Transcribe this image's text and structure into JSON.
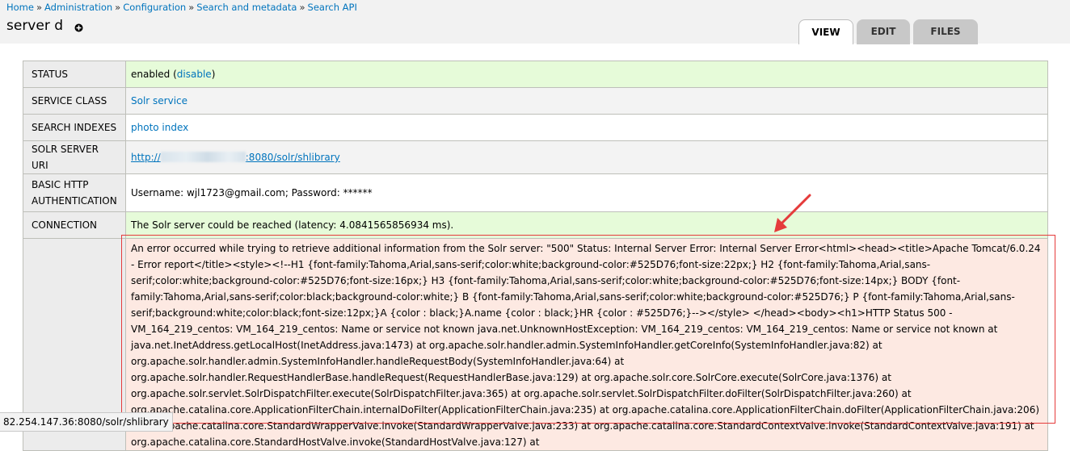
{
  "breadcrumb": {
    "items": [
      "Home",
      "Administration",
      "Configuration",
      "Search and metadata",
      "Search API"
    ],
    "separator": "»"
  },
  "page": {
    "title": "server d"
  },
  "tabs": [
    {
      "label": "VIEW",
      "active": true
    },
    {
      "label": "EDIT",
      "active": false
    },
    {
      "label": "FILES",
      "active": false
    }
  ],
  "table": {
    "status": {
      "label": "STATUS",
      "value": "enabled",
      "link": "disable"
    },
    "service_class": {
      "label": "SERVICE CLASS",
      "value": "Solr service"
    },
    "search_indexes": {
      "label": "SEARCH INDEXES",
      "value": "photo index"
    },
    "solr_server_uri": {
      "label": "SOLR SERVER URI",
      "prefix": "http://",
      "suffix": ":8080/solr/shlibrary"
    },
    "basic_http_auth": {
      "label_line1": "BASIC HTTP",
      "label_line2": "AUTHENTICATION",
      "value": "Username: wjl1723@gmail.com; Password: ******"
    },
    "connection": {
      "label": "CONNECTION",
      "value": "The Solr server could be reached (latency: 4.0841565856934 ms)."
    },
    "error": {
      "value": "An error occurred while trying to retrieve additional information from the Solr server: \"500\" Status: Internal Server Error: Internal Server Error<html><head><title>Apache Tomcat/6.0.24 - Error report</title><style><!--H1 {font-family:Tahoma,Arial,sans-serif;color:white;background-color:#525D76;font-size:22px;} H2 {font-family:Tahoma,Arial,sans-serif;color:white;background-color:#525D76;font-size:16px;} H3 {font-family:Tahoma,Arial,sans-serif;color:white;background-color:#525D76;font-size:14px;} BODY {font-family:Tahoma,Arial,sans-serif;color:black;background-color:white;} B {font-family:Tahoma,Arial,sans-serif;color:white;background-color:#525D76;} P {font-family:Tahoma,Arial,sans-serif;background:white;color:black;font-size:12px;}A {color : black;}A.name {color : black;}HR {color : #525D76;}--></style> </head><body><h1>HTTP Status 500 - VM_164_219_centos: VM_164_219_centos: Name or service not known java.net.UnknownHostException: VM_164_219_centos: VM_164_219_centos: Name or service not known at java.net.InetAddress.getLocalHost(InetAddress.java:1473) at org.apache.solr.handler.admin.SystemInfoHandler.getCoreInfo(SystemInfoHandler.java:82) at org.apache.solr.handler.admin.SystemInfoHandler.handleRequestBody(SystemInfoHandler.java:64) at org.apache.solr.handler.RequestHandlerBase.handleRequest(RequestHandlerBase.java:129) at org.apache.solr.core.SolrCore.execute(SolrCore.java:1376) at org.apache.solr.servlet.SolrDispatchFilter.execute(SolrDispatchFilter.java:365) at org.apache.solr.servlet.SolrDispatchFilter.doFilter(SolrDispatchFilter.java:260) at org.apache.catalina.core.ApplicationFilterChain.internalDoFilter(ApplicationFilterChain.java:235) at org.apache.catalina.core.ApplicationFilterChain.doFilter(ApplicationFilterChain.java:206) at org.apache.catalina.core.StandardWrapperValve.invoke(StandardWrapperValve.java:233) at org.apache.catalina.core.StandardContextValve.invoke(StandardContextValve.java:191) at org.apache.catalina.core.StandardHostValve.invoke(StandardHostValve.java:127) at"
    }
  },
  "status_bar": {
    "url": "82.254.147.36:8080/solr/shlibrary"
  },
  "colors": {
    "link": "#0074bd",
    "ok_row": "#e6fbd9",
    "error_row": "#fde9e2",
    "annotation": "#e53b3b"
  }
}
